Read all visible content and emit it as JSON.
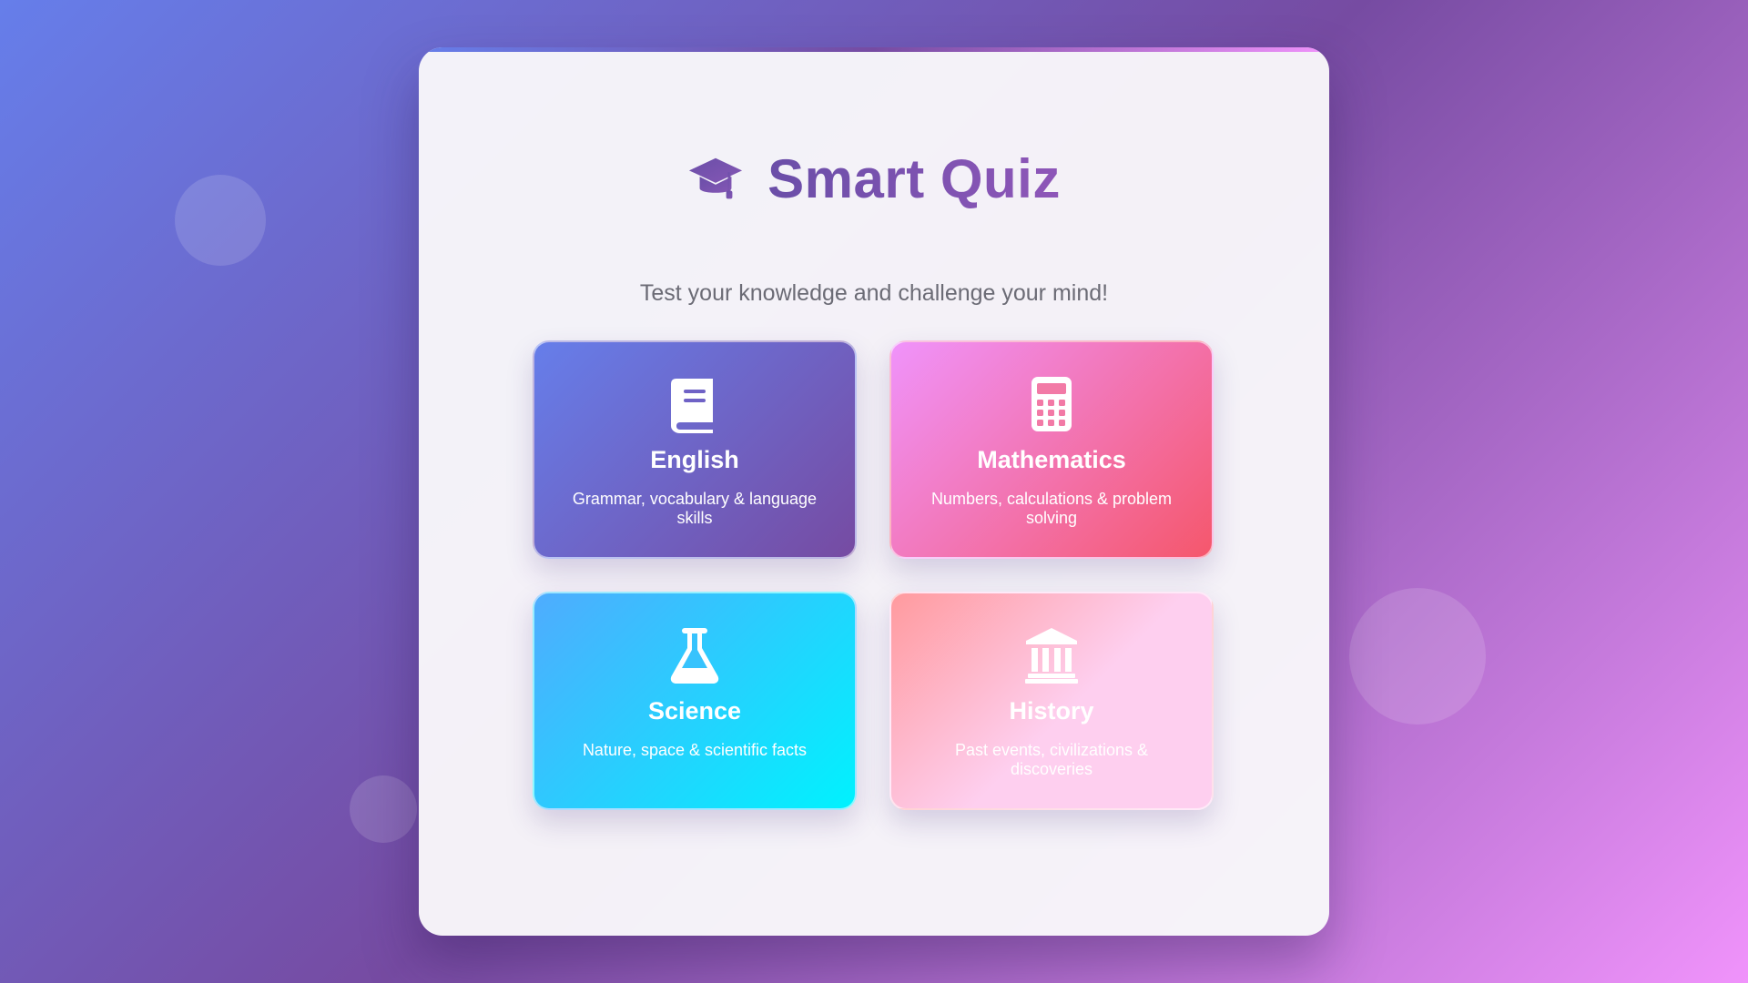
{
  "app": {
    "title": "Smart Quiz",
    "subtitle": "Test your knowledge and challenge your mind!",
    "logo_icon": "graduation-cap-icon"
  },
  "subjects": [
    {
      "name": "English",
      "description": "Grammar, vocabulary & language skills",
      "icon": "book-icon",
      "gradient": [
        "#667eea",
        "#764ba2"
      ]
    },
    {
      "name": "Mathematics",
      "description": "Numbers, calculations & problem solving",
      "icon": "calculator-icon",
      "gradient": [
        "#f093fb",
        "#f5576c"
      ]
    },
    {
      "name": "Science",
      "description": "Nature, space & scientific facts",
      "icon": "flask-icon",
      "gradient": [
        "#4facfe",
        "#00f2fe"
      ]
    },
    {
      "name": "History",
      "description": "Past events, civilizations & discoveries",
      "icon": "landmark-icon",
      "gradient": [
        "#ff9a9e",
        "#fecfef"
      ]
    }
  ],
  "colors": {
    "background_gradient": [
      "#667eea",
      "#764ba2",
      "#f093fb"
    ],
    "title_color": "#764ba2",
    "subtitle_color": "#6b6b75"
  }
}
